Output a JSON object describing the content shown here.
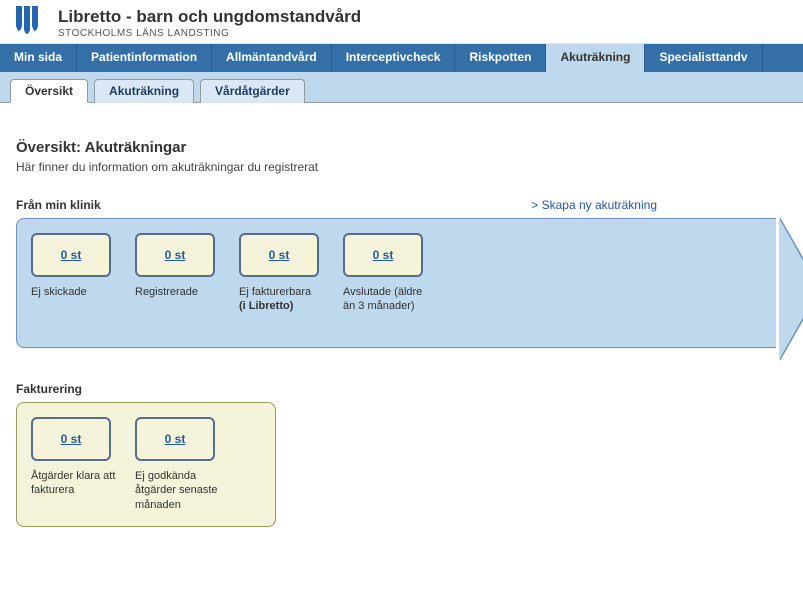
{
  "header": {
    "title": "Libretto - barn och ungdomstandvård",
    "subtitle": "STOCKHOLMS LÄNS LANDSTING"
  },
  "nav": {
    "items": [
      "Min sida",
      "Patientinformation",
      "Allmäntandvård",
      "Interceptivcheck",
      "Riskpotten",
      "Akuträkning",
      "Specialisttandv"
    ],
    "active_index": 5
  },
  "tabs": {
    "items": [
      "Översikt",
      "Akuträkning",
      "Vårdåtgärder"
    ],
    "active_index": 0
  },
  "page": {
    "title": "Översikt: Akuträkningar",
    "subtitle": "Här finner du information om akuträkningar du registrerat"
  },
  "clinic": {
    "label": "Från min klinik",
    "create_link": "> Skapa ny akuträkning",
    "cards": [
      {
        "count": "0 st",
        "label": "Ej skickade"
      },
      {
        "count": "0 st",
        "label": "Registrerade"
      },
      {
        "count": "0 st",
        "label": "Ej fakturerbara",
        "label_bold": "(i Libretto)"
      },
      {
        "count": "0 st",
        "label": "Avslutade (äldre än 3 månader)"
      }
    ]
  },
  "billing": {
    "label": "Fakturering",
    "cards": [
      {
        "count": "0 st",
        "label": "Åtgärder klara att fakturera"
      },
      {
        "count": "0 st",
        "label": "Ej godkända åtgärder senaste månaden"
      }
    ]
  }
}
